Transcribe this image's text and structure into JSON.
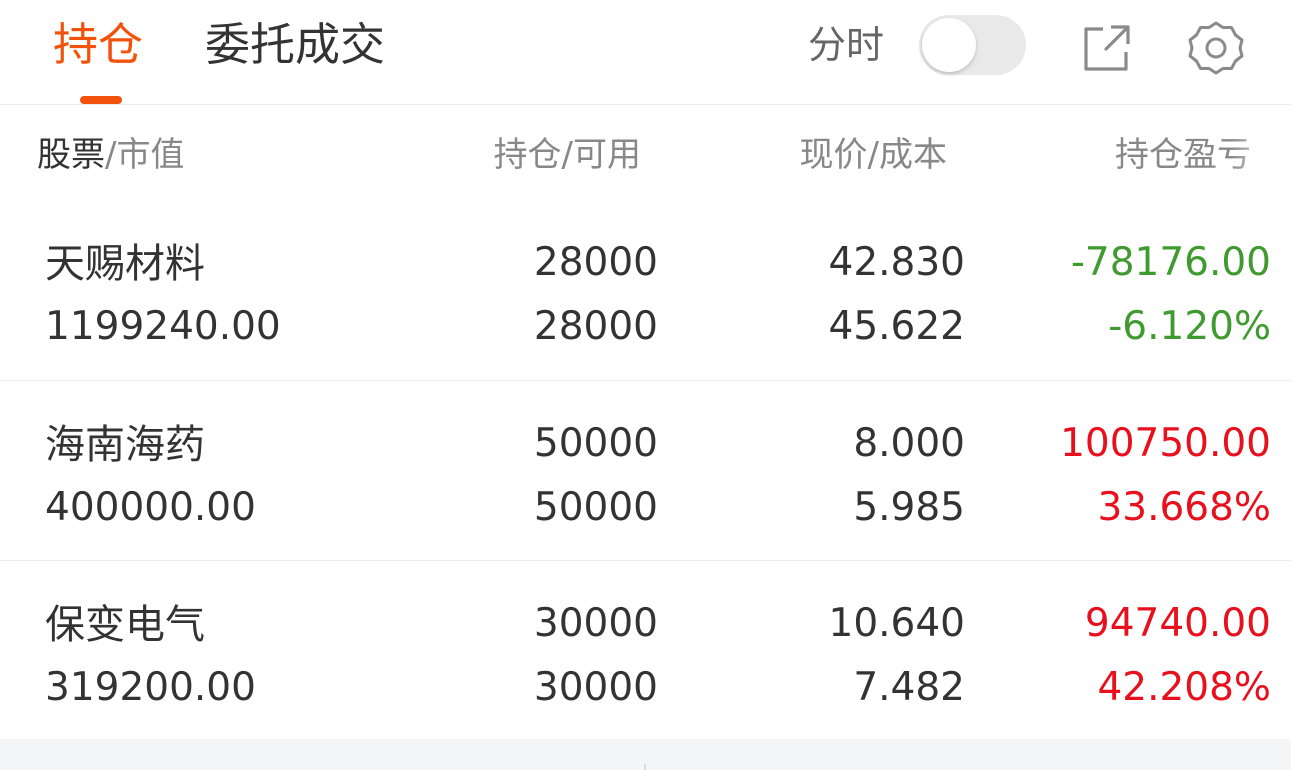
{
  "tabs": {
    "positions": "持仓",
    "orders": "委托成交"
  },
  "header": {
    "split_label": "分时",
    "toggle_on": false
  },
  "icons": {
    "export": "external-link-icon",
    "settings": "gear-icon"
  },
  "colors": {
    "accent": "#f2520b",
    "gain": "#e8101d",
    "loss": "#3f9b2f"
  },
  "columns": {
    "stock": "股票",
    "stock_sep": "/",
    "market_value": "市值",
    "position_available": "持仓/可用",
    "price_cost": "现价/成本",
    "pnl": "持仓盈亏"
  },
  "holdings": [
    {
      "name": "天赐材料",
      "market_value": "1199240.00",
      "position": "28000",
      "available": "28000",
      "price": "42.830",
      "cost": "45.622",
      "pnl": "-78176.00",
      "pnl_pct": "-6.120%",
      "direction": "loss"
    },
    {
      "name": "海南海药",
      "market_value": "400000.00",
      "position": "50000",
      "available": "50000",
      "price": "8.000",
      "cost": "5.985",
      "pnl": "100750.00",
      "pnl_pct": "33.668%",
      "direction": "gain"
    },
    {
      "name": "保变电气",
      "market_value": "319200.00",
      "position": "30000",
      "available": "30000",
      "price": "10.640",
      "cost": "7.482",
      "pnl": "94740.00",
      "pnl_pct": "42.208%",
      "direction": "gain"
    }
  ]
}
